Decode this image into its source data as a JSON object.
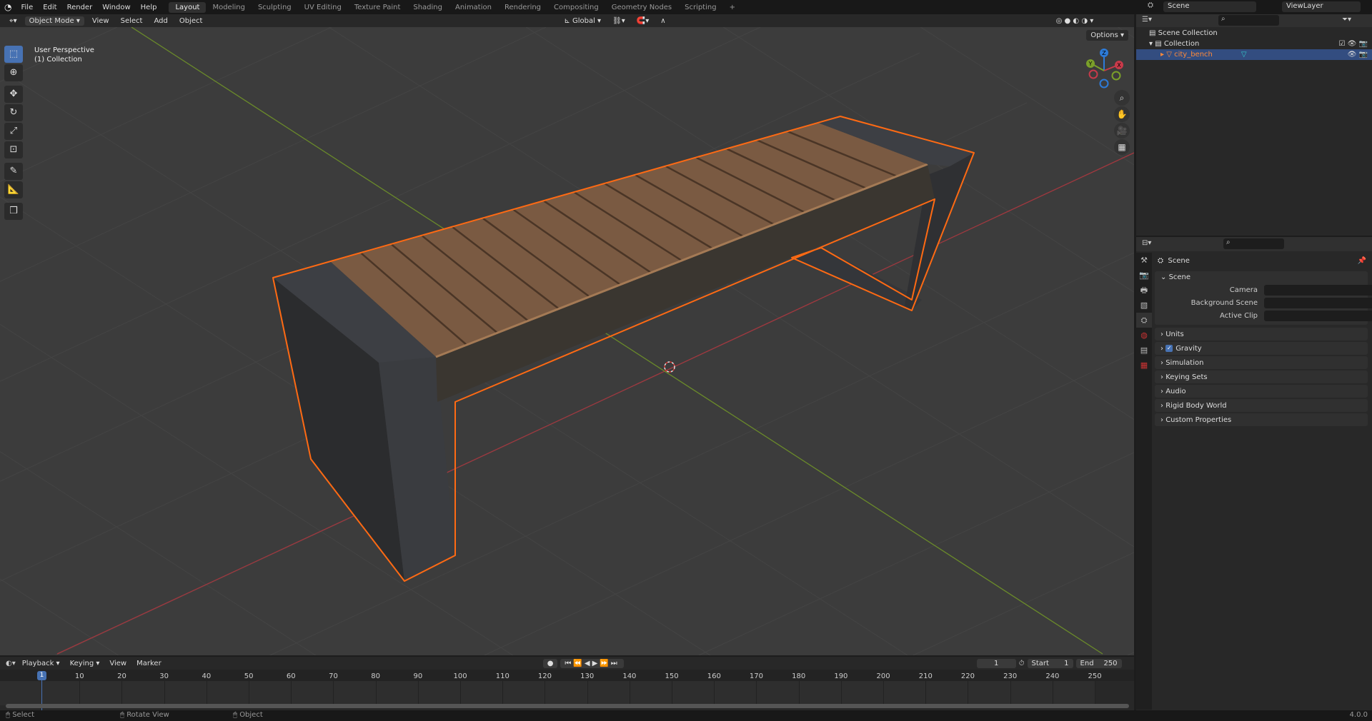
{
  "topbar": {
    "menus": [
      "File",
      "Edit",
      "Render",
      "Window",
      "Help"
    ],
    "workspaces": [
      "Layout",
      "Modeling",
      "Sculpting",
      "UV Editing",
      "Texture Paint",
      "Shading",
      "Animation",
      "Rendering",
      "Compositing",
      "Geometry Nodes",
      "Scripting"
    ],
    "active_workspace": "Layout",
    "add": "+",
    "scene": "Scene",
    "view_layer": "ViewLayer"
  },
  "viewport": {
    "mode": "Object Mode",
    "menus": [
      "View",
      "Select",
      "Add",
      "Object"
    ],
    "orientation": "Global",
    "options": "Options",
    "overlay_title": "User Perspective",
    "overlay_sub": "(1) Collection",
    "gizmo": {
      "x": "X",
      "y": "Y",
      "z": "Z"
    }
  },
  "outliner": {
    "scene_collection": "Scene Collection",
    "collection": "Collection",
    "object": "city_bench"
  },
  "properties": {
    "context": "Scene",
    "panel": "Scene",
    "camera_label": "Camera",
    "bg_label": "Background Scene",
    "clip_label": "Active Clip",
    "sections": [
      "Units",
      "Gravity",
      "Simulation",
      "Keying Sets",
      "Audio",
      "Rigid Body World",
      "Custom Properties"
    ],
    "gravity_checked": true
  },
  "timeline": {
    "menus": [
      "Playback",
      "Keying",
      "View",
      "Marker"
    ],
    "current_frame": "1",
    "start_label": "Start",
    "start": "1",
    "end_label": "End",
    "end": "250",
    "ticks": [
      10,
      20,
      30,
      40,
      50,
      60,
      70,
      80,
      90,
      100,
      110,
      120,
      130,
      140,
      150,
      160,
      170,
      180,
      190,
      200,
      210,
      220,
      230,
      240,
      250
    ],
    "playhead": "1"
  },
  "status": {
    "select": "Select",
    "rotate": "Rotate View",
    "object": "Object",
    "version": "4.0.0"
  },
  "colors": {
    "accent": "#4772b3",
    "selection": "#ff6a13",
    "x_axis": "#c83a4a",
    "y_axis": "#7ba02a",
    "z_axis": "#2d7bd8"
  }
}
